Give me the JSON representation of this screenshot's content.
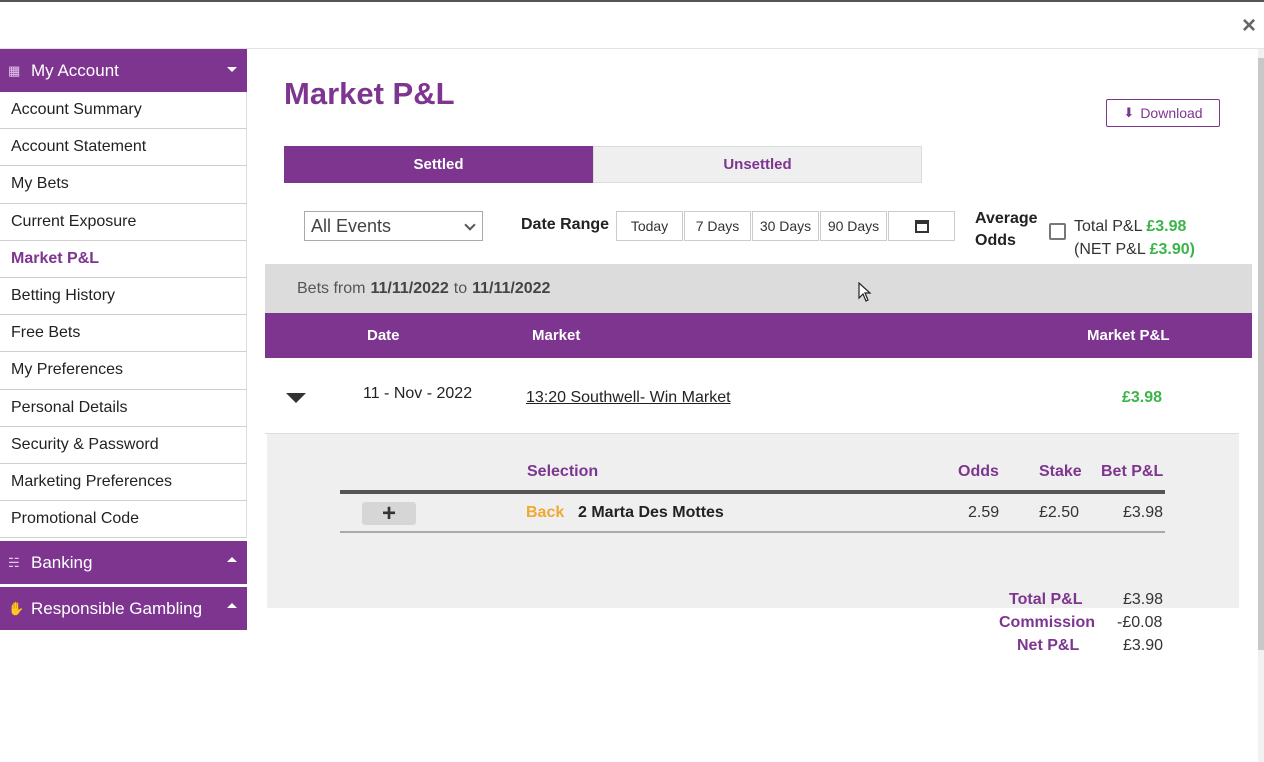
{
  "window": {
    "close_glyph": "×"
  },
  "sidebar": {
    "my_account": "My Account",
    "items": [
      "Account Summary",
      "Account Statement",
      "My Bets",
      "Current Exposure",
      "Market P&L",
      "Betting History",
      "Free Bets",
      "My Preferences",
      "Personal Details",
      "Security & Password",
      "Marketing Preferences",
      "Promotional Code"
    ],
    "banking": "Banking",
    "responsible_gambling": "Responsible Gambling"
  },
  "page": {
    "title": "Market P&L",
    "download_label": "Download"
  },
  "tabs": {
    "settled": "Settled",
    "unsettled": "Unsettled"
  },
  "filters": {
    "event_selected": "All Events",
    "date_range_label": "Date Range",
    "ranges": [
      "Today",
      "7 Days",
      "30 Days",
      "90 Days"
    ],
    "average_odds_line1": "Average",
    "average_odds_line2": "Odds",
    "total_pl_label": "Total P&L",
    "total_pl_value": "£3.98",
    "net_pl_label_open": "(NET P&L",
    "net_pl_value": "£3.90)"
  },
  "bets_from": {
    "prefix": "Bets from",
    "from": "11/11/2022",
    "to_word": "to",
    "to": "11/11/2022"
  },
  "table": {
    "headers": {
      "date": "Date",
      "market": "Market",
      "market_pl": "Market P&L"
    },
    "row": {
      "date": "11 - Nov - 2022",
      "market": "13:20 Southwell- Win Market",
      "pl": "£3.98"
    }
  },
  "detail": {
    "headers": {
      "selection": "Selection",
      "odds": "Odds",
      "stake": "Stake",
      "bet_pl": "Bet P&L"
    },
    "bet": {
      "type": "Back",
      "selection": "2 Marta Des Mottes",
      "odds": "2.59",
      "stake": "£2.50",
      "bet_pl": "£3.98"
    },
    "summary": {
      "total_pl_label": "Total P&L",
      "total_pl": "£3.98",
      "commission_label": "Commission",
      "commission": "-£0.08",
      "net_pl_label": "Net P&L",
      "net_pl": "£3.90"
    }
  },
  "colors": {
    "brand": "#7d3590",
    "positive": "#3bb54a",
    "back": "#f0a832"
  }
}
